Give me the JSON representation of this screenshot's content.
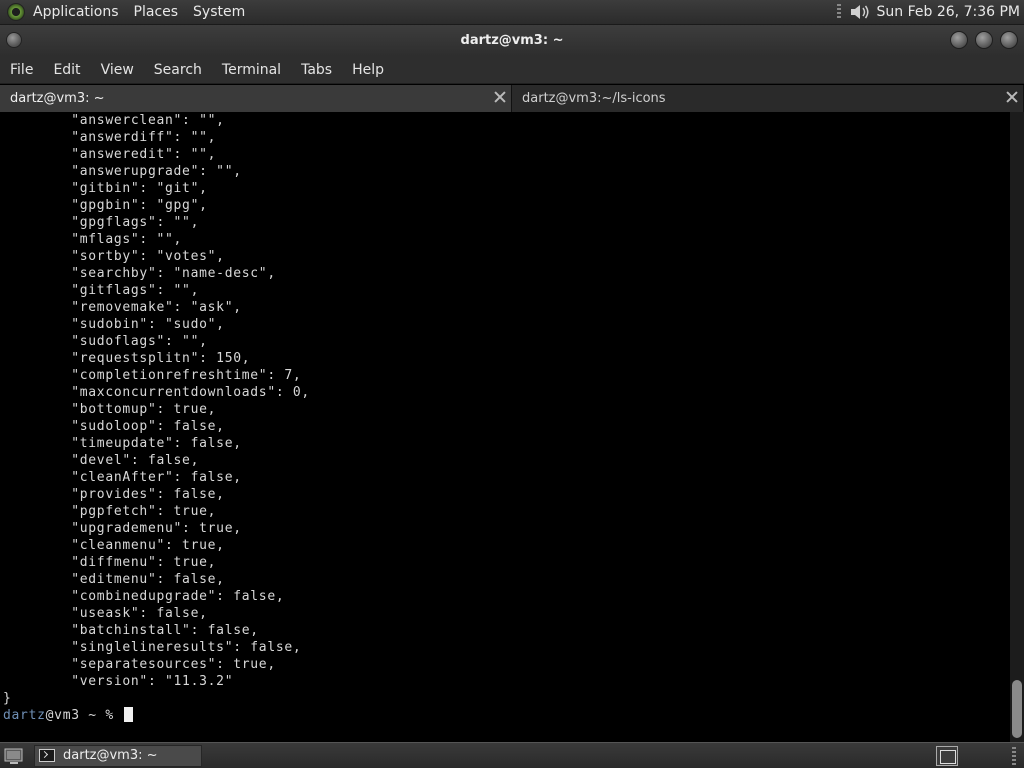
{
  "top_panel": {
    "menus": [
      "Applications",
      "Places",
      "System"
    ],
    "clock": "Sun Feb 26,  7:36 PM",
    "icons": [
      "distro-logo-icon",
      "volume-icon"
    ]
  },
  "window": {
    "title": "dartz@vm3: ~"
  },
  "menubar": {
    "items": [
      "File",
      "Edit",
      "View",
      "Search",
      "Terminal",
      "Tabs",
      "Help"
    ]
  },
  "tabs": [
    {
      "label": "dartz@vm3: ~",
      "active": true
    },
    {
      "label": "dartz@vm3:~/ls-icons",
      "active": false
    }
  ],
  "terminal": {
    "lines": [
      "        \"answerclean\": \"\",",
      "        \"answerdiff\": \"\",",
      "        \"answeredit\": \"\",",
      "        \"answerupgrade\": \"\",",
      "        \"gitbin\": \"git\",",
      "        \"gpgbin\": \"gpg\",",
      "        \"gpgflags\": \"\",",
      "        \"mflags\": \"\",",
      "        \"sortby\": \"votes\",",
      "        \"searchby\": \"name-desc\",",
      "        \"gitflags\": \"\",",
      "        \"removemake\": \"ask\",",
      "        \"sudobin\": \"sudo\",",
      "        \"sudoflags\": \"\",",
      "        \"requestsplitn\": 150,",
      "        \"completionrefreshtime\": 7,",
      "        \"maxconcurrentdownloads\": 0,",
      "        \"bottomup\": true,",
      "        \"sudoloop\": false,",
      "        \"timeupdate\": false,",
      "        \"devel\": false,",
      "        \"cleanAfter\": false,",
      "        \"provides\": false,",
      "        \"pgpfetch\": true,",
      "        \"upgrademenu\": true,",
      "        \"cleanmenu\": true,",
      "        \"diffmenu\": true,",
      "        \"editmenu\": false,",
      "        \"combinedupgrade\": false,",
      "        \"useask\": false,",
      "        \"batchinstall\": false,",
      "        \"singlelineresults\": false,",
      "        \"separatesources\": true,",
      "        \"version\": \"11.3.2\"",
      "}"
    ],
    "prompt": {
      "user": "dartz",
      "host": "@vm3",
      "rest": " ~ % "
    },
    "colors": {
      "background": "#000000",
      "foreground": "#d8d8d8",
      "prompt_user": "#6f8fb5"
    }
  },
  "bottom_panel": {
    "taskbar_item": "dartz@vm3: ~",
    "icons": [
      "show-desktop-icon",
      "terminal-icon",
      "workspace-switcher-icon"
    ]
  }
}
